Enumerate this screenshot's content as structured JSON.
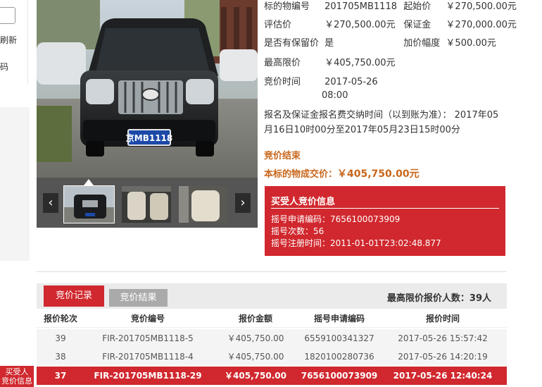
{
  "left": {
    "refresh_label": "刷新",
    "code_label": "码"
  },
  "info": {
    "item_no_label": "标的物编号",
    "item_no": "201705MB1118",
    "start_price_label": "起始价",
    "start_price": "￥270,500.00元",
    "appraisal_label": "评估价",
    "appraisal": "￥270,500.00元",
    "deposit_label": "保证金",
    "deposit": "￥270,000.00元",
    "reserve_label": "是否有保留价",
    "reserve": "是",
    "increment_label": "加价幅度",
    "increment": "￥500.00元",
    "max_price_label": "最高限价",
    "max_price": "￥405,750.00元",
    "bid_time_label": "竞价时间",
    "bid_time_date": "2017-05-26",
    "bid_time_clock": "08:00",
    "notice_line1": "报名及保证金报名费交纳时间（以到账为准）： 2017年05",
    "notice_line2": "月16日10时00分至2017年05月23日15时00分",
    "status": "竞价结束",
    "deal_label": "本标的物成交价：",
    "deal_amount": "￥405,750.00元"
  },
  "winner": {
    "title": "买受人竞价信息",
    "app_code": "摇号申请编码：7656100073909",
    "lottery_count": "摇号次数：56",
    "reg_time": "摇号注册时间：2011-01-01T23:02:48.877"
  },
  "records": {
    "tab_records": "竞价记录",
    "tab_results": "竞价结果",
    "max_bidders": "最高限价报价人数：39人",
    "headers": [
      "报价轮次",
      "竞价编号",
      "报价金额",
      "摇号申请编码",
      "报价时间"
    ],
    "rows": [
      [
        "39",
        "FIR-201705MB1118-5",
        "￥405,750.00",
        "6559100341327",
        "2017-05-26 15:57:42"
      ],
      [
        "38",
        "FIR-201705MB1118-4",
        "￥405,750.00",
        "1820100280736",
        "2017-05-26 14:20:19"
      ],
      [
        "37",
        "FIR-201705MB1118-29",
        "￥405,750.00",
        "7656100073909",
        "2017-05-26 12:40:24"
      ]
    ]
  },
  "side_badge": {
    "line1": "买受人",
    "line2": "竞价信息"
  },
  "colors": {
    "accent_red": "#d0282e",
    "status_orange": "#c9661a"
  },
  "icons": {
    "prev": "chevron-left-icon",
    "next": "chevron-right-icon"
  }
}
